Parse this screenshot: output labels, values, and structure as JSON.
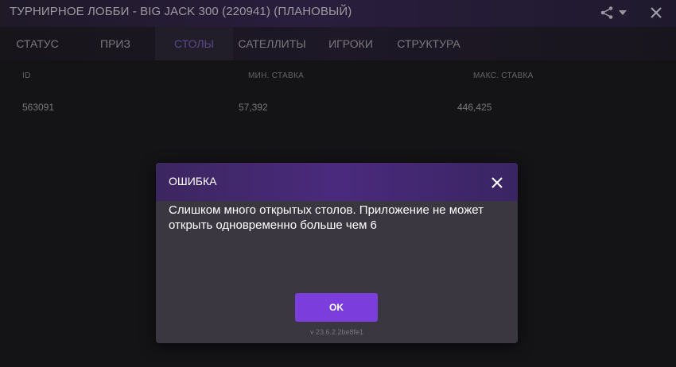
{
  "window": {
    "title": "ТУРНИРНОЕ ЛОББИ - BIG JACK 300 (220941) (ПЛАНОВЫЙ)"
  },
  "tabs": [
    {
      "label": "СТАТУС"
    },
    {
      "label": "ПРИЗ"
    },
    {
      "label": "СТОЛЫ",
      "active": true
    },
    {
      "label": "САТЕЛЛИТЫ"
    },
    {
      "label": "ИГРОКИ"
    },
    {
      "label": "СТРУКТУРА"
    }
  ],
  "table": {
    "headers": [
      "ID",
      "МИН. СТАВКА",
      "МАКС. СТАВКА"
    ],
    "rows": [
      {
        "id": "563091",
        "min": "57,392",
        "max": "446,425"
      }
    ]
  },
  "dialog": {
    "title": "ОШИБКА",
    "message": "Слишком много открытых столов. Приложение не может открыть одновременно больше чем 6",
    "ok_label": "OK",
    "version": "v 23.6.2.2be8fe1"
  },
  "colors": {
    "accent": "#7b3ddb",
    "active_tab_text": "#7e62c4",
    "header_purple": "#4a2a7d"
  },
  "icons": {
    "share": "share-icon",
    "dropdown": "chevron-down-icon",
    "close": "close-icon"
  }
}
